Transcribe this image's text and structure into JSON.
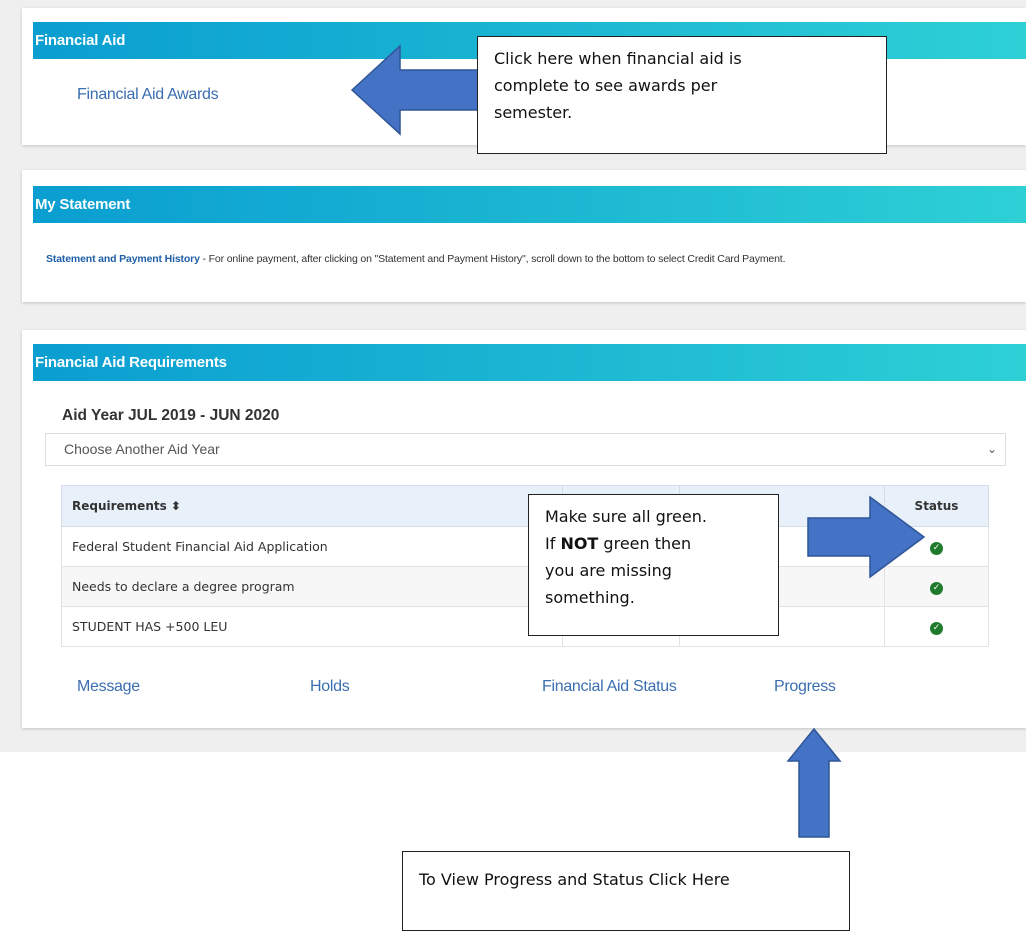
{
  "financial_aid": {
    "title": "Financial Aid",
    "awards_link": "Financial Aid Awards",
    "external_icon": "external-link-icon"
  },
  "statement": {
    "title": "My Statement",
    "link_label": "Statement and Payment History",
    "description": " - For online payment, after clicking on \"Statement and Payment History\", scroll down to the bottom to select Credit Card Payment."
  },
  "requirements": {
    "title": "Financial Aid Requirements",
    "aid_year": "Aid Year JUL 2019 - JUN 2020",
    "select_value": "Choose Another Aid Year",
    "select_icon": "chevron-down-icon",
    "columns": [
      "Requirements ⬍",
      "",
      "⬍",
      "Status"
    ],
    "rows": [
      {
        "requirement": "Federal Student Financial Aid Application",
        "status": "complete"
      },
      {
        "requirement": "Needs to declare a degree program",
        "status": "complete"
      },
      {
        "requirement": "STUDENT HAS +500 LEU",
        "status": "complete"
      }
    ],
    "status_icon": "check-circle-icon",
    "status_color": "#1f7a2c",
    "links": {
      "message": "Message",
      "holds": "Holds",
      "fa_status": "Financial Aid Status",
      "progress": "Progress"
    }
  },
  "annotations": {
    "awards_callout": [
      "Click here when financial aid is",
      "complete to see awards per",
      "semester."
    ],
    "status_callout_line1": "Make sure all green.",
    "status_callout_line2_pre": "If ",
    "status_callout_line2_bold": "NOT",
    "status_callout_line2_post": " green then",
    "status_callout_line3": "you are missing",
    "status_callout_line4": "something.",
    "progress_callout": "To View Progress and Status Click Here",
    "arrow_color": "#4472c4"
  }
}
